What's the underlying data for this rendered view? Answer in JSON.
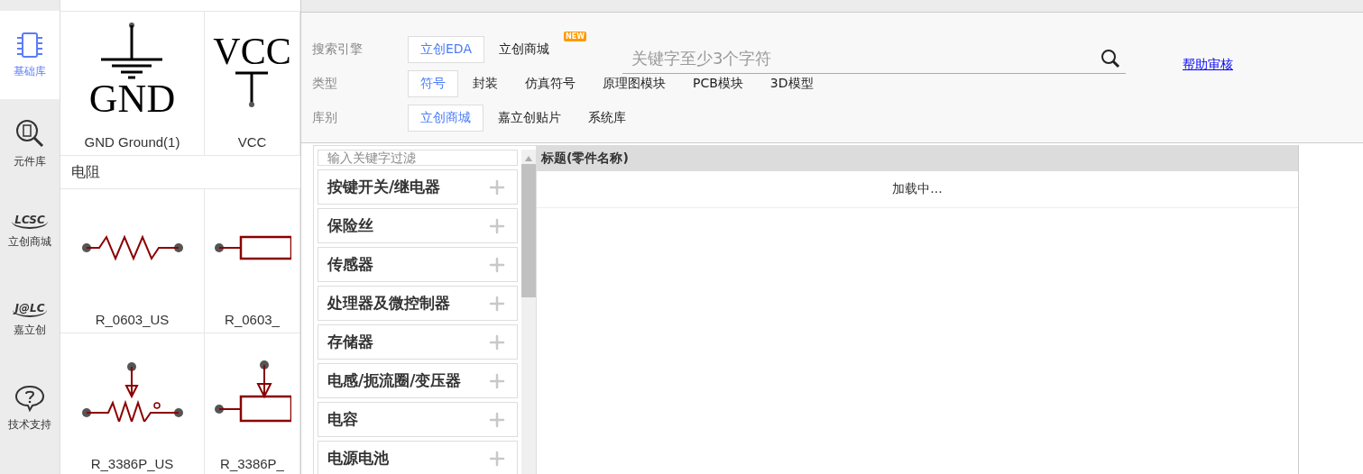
{
  "nav": [
    {
      "label": "基础库",
      "kind": "chip",
      "selected": true
    },
    {
      "label": "元件库",
      "kind": "chip-search",
      "selected": false
    },
    {
      "label": "立创商城",
      "kind": "logo",
      "logo": "LCSC",
      "selected": false
    },
    {
      "label": "嘉立创",
      "kind": "logo",
      "logo": "J@LC",
      "selected": false
    },
    {
      "label": "技术支持",
      "kind": "help",
      "selected": false
    }
  ],
  "library": {
    "top_cards": [
      {
        "label": "GND Ground(1)",
        "kind": "gnd",
        "symbol_text": "GND"
      },
      {
        "label": "VCC",
        "kind": "vcc",
        "symbol_text": "VCC"
      }
    ],
    "sections": [
      {
        "title": "电阻",
        "cards": [
          {
            "label": "R_0603_US",
            "kind": "zigzag"
          },
          {
            "label": "R_0603_",
            "kind": "box"
          },
          {
            "label": "R_3386P_US",
            "kind": "pot-zigzag"
          },
          {
            "label": "R_3386P_",
            "kind": "pot-box"
          }
        ]
      }
    ]
  },
  "dialog": {
    "filters": [
      {
        "label": "搜索引擎",
        "options": [
          {
            "label": "立创EDA",
            "selected": true
          },
          {
            "label": "立创商城",
            "selected": false,
            "badge": "NEW"
          }
        ]
      },
      {
        "label": "类型",
        "options": [
          {
            "label": "符号",
            "selected": true
          },
          {
            "label": "封装",
            "selected": false
          },
          {
            "label": "仿真符号",
            "selected": false
          },
          {
            "label": "原理图模块",
            "selected": false
          },
          {
            "label": "PCB模块",
            "selected": false
          },
          {
            "label": "3D模型",
            "selected": false
          }
        ]
      },
      {
        "label": "库别",
        "options": [
          {
            "label": "立创商城",
            "selected": true
          },
          {
            "label": "嘉立创贴片",
            "selected": false
          },
          {
            "label": "系统库",
            "selected": false
          }
        ]
      }
    ],
    "search": {
      "placeholder": "关键字至少3个字符"
    },
    "help_link": "帮助审核",
    "category_filter": {
      "placeholder": "输入关键字过滤"
    },
    "categories": [
      "按键开关/继电器",
      "保险丝",
      "传感器",
      "处理器及微控制器",
      "存储器",
      "电感/扼流圈/变压器",
      "电容",
      "电源电池"
    ],
    "table": {
      "columns": [
        "标题(零件名称)"
      ],
      "status": "加载中..."
    }
  }
}
